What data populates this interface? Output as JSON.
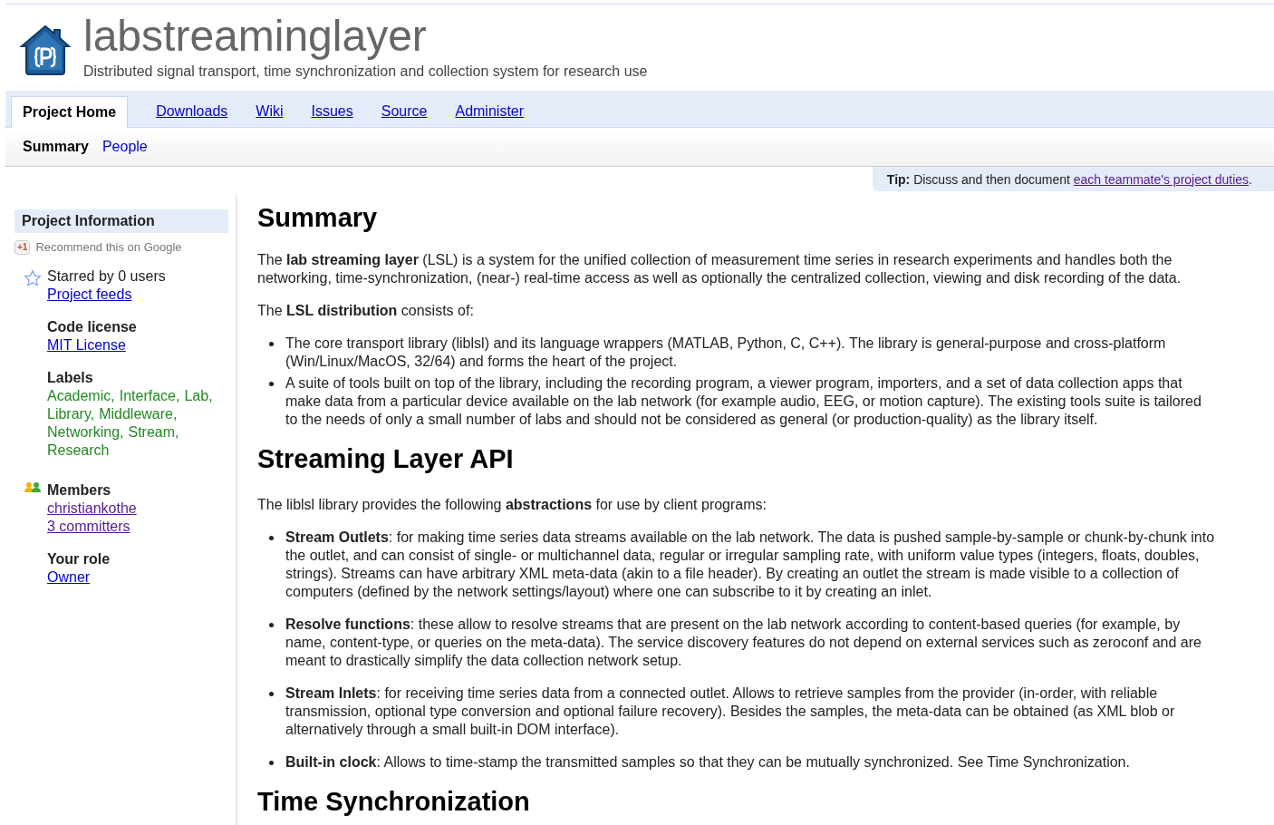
{
  "header": {
    "title": "labstreaminglayer",
    "subtitle": "Distributed signal transport, time synchronization and collection system for research use"
  },
  "tabs": [
    {
      "label": "Project Home",
      "selected": true
    },
    {
      "label": "Downloads",
      "selected": false
    },
    {
      "label": "Wiki",
      "selected": false
    },
    {
      "label": "Issues",
      "selected": false
    },
    {
      "label": "Source",
      "selected": false
    },
    {
      "label": "Administer",
      "selected": false
    }
  ],
  "subtabs": [
    {
      "label": "Summary",
      "selected": true
    },
    {
      "label": "People",
      "selected": false
    }
  ],
  "tip": {
    "label": "Tip:",
    "text": "Discuss and then document",
    "link": "each teammate's project duties",
    "after": "."
  },
  "sidebar": {
    "title": "Project Information",
    "plus_one": {
      "badge": "+1",
      "text": "Recommend this on Google"
    },
    "starred": "Starred by 0 users",
    "feeds": {
      "label": "Project feeds",
      "visited": false
    },
    "license": {
      "heading": "Code license",
      "link": {
        "label": "MIT License",
        "visited": false
      }
    },
    "labels": {
      "heading": "Labels",
      "separator": ",",
      "items": [
        "Academic",
        "Interface",
        "Lab",
        "Library",
        "Middleware",
        "Networking",
        "Stream",
        "Research"
      ]
    },
    "members": {
      "heading": "Members",
      "links": [
        {
          "label": "christiankothe",
          "visited": true
        },
        {
          "label": "3 committers",
          "visited": true
        }
      ]
    },
    "role": {
      "heading": "Your role",
      "link": {
        "label": "Owner",
        "visited": false
      }
    }
  },
  "content": [
    {
      "kind": "h1",
      "text": "Summary"
    },
    {
      "kind": "p",
      "text": "The **lab streaming layer** (LSL) is a system for the unified collection of measurement time series in research experiments and handles both the networking, time-synchronization, (near-) real-time access as well as optionally the centralized collection, viewing and disk recording of the data."
    },
    {
      "kind": "p",
      "text": "The **LSL distribution** consists of:"
    },
    {
      "kind": "list",
      "items": [
        "The core transport library (liblsl) and its language wrappers (MATLAB, Python, C, C++). The library is general-purpose and cross-platform (Win/Linux/MacOS, 32/64) and forms the heart of the project.",
        "A suite of tools built on top of the library, including the recording program, a viewer program, importers, and a set of data collection apps that make data from a particular device available on the lab network (for example audio, EEG, or motion capture). The existing tools suite is tailored to the needs of only a small number of labs and should not be considered as general (or production-quality) as the library itself."
      ]
    },
    {
      "kind": "h1",
      "text": "Streaming Layer API"
    },
    {
      "kind": "p",
      "text": "The liblsl library provides the following **abstractions** for use by client programs:"
    },
    {
      "kind": "spaced_list",
      "items": [
        "**Stream Outlets**: for making time series data streams available on the lab network. The data is pushed sample-by-sample or chunk-by-chunk into the outlet, and can consist of single- or multichannel data, regular or irregular sampling rate, with uniform value types (integers, floats, doubles, strings). Streams can have arbitrary XML meta-data (akin to a file header). By creating an outlet the stream is made visible to a collection of computers (defined by the network settings/layout) where one can subscribe to it by creating an inlet.",
        "**Resolve functions**: these allow to resolve streams that are present on the lab network according to content-based queries (for example, by name, content-type, or queries on the meta-data). The service discovery features do not depend on external services such as zeroconf and are meant to drastically simplify the data collection network setup.",
        "**Stream Inlets**: for receiving time series data from a connected outlet. Allows to retrieve samples from the provider (in-order, with reliable transmission, optional type conversion and optional failure recovery). Besides the samples, the meta-data can be obtained (as XML blob or alternatively through a small built-in DOM interface).",
        "**Built-in clock**: Allows to time-stamp the transmitted samples so that they can be mutually synchronized. See Time Synchronization."
      ]
    },
    {
      "kind": "h1",
      "text": "Time Synchronization"
    }
  ]
}
